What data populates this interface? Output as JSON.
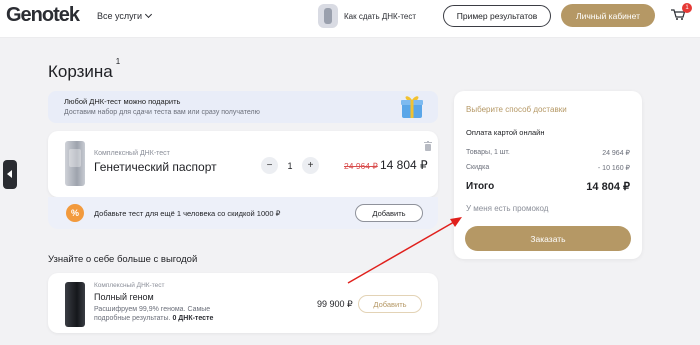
{
  "header": {
    "logo": "Genotek",
    "services_label": "Все услуги",
    "howto_label": "Как сдать ДНК-тест",
    "example_button": "Пример результатов",
    "cabinet_button": "Личный кабинет",
    "cart_count": "1"
  },
  "page": {
    "title": "Корзина",
    "title_count": "1"
  },
  "gift": {
    "title": "Любой ДНК-тест можно подарить",
    "subtitle": "Доставим набор для сдачи теста вам или сразу получателю"
  },
  "cart_item": {
    "type": "Комплексный ДНК-тест",
    "name": "Генетический паспорт",
    "qty_minus": "−",
    "qty_value": "1",
    "qty_plus": "+",
    "old_price": "24 964 ₽",
    "new_price": "14 804 ₽"
  },
  "add_test": {
    "badge": "%",
    "text": "Добавьте тест для ещё 1 человека со скидкой 1000 ₽",
    "button": "Добавить"
  },
  "recommendations": {
    "title": "Узнайте о себе больше с выгодой",
    "item": {
      "type": "Комплексный ДНК-тест",
      "name": "Полный геном",
      "description_prefix": "Расшифруем 99,9% генома. Самые подробные результаты. ",
      "description_bold": "0 ДНК-тесте",
      "price": "99 900 ₽",
      "button": "Добавить"
    }
  },
  "summary": {
    "delivery": "Выберите способ доставки",
    "payment": "Оплата картой онлайн",
    "goods_label": "Товары, 1 шт.",
    "goods_value": "24 964 ₽",
    "discount_label": "Скидка",
    "discount_value": "- 10 160 ₽",
    "total_label": "Итого",
    "total_value": "14 804 ₽",
    "promo": "У меня есть промокод",
    "order_button": "Заказать"
  },
  "colors": {
    "accent": "#b59865",
    "badge_red": "#e53935",
    "annotation_arrow": "#e0201c"
  }
}
